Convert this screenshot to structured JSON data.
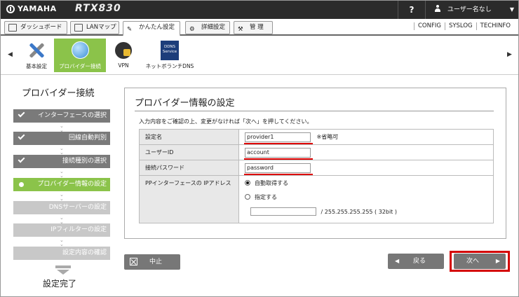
{
  "brand": "YAMAHA",
  "model": "RTX830",
  "help": "?",
  "user": "ユーザー名なし",
  "nav": {
    "tabs": [
      "ダッシュボード",
      "LANマップ",
      "かんたん設定",
      "詳細設定",
      "管 理"
    ],
    "links": [
      "CONFIG",
      "SYSLOG",
      "TECHINFO"
    ]
  },
  "categories": [
    "基本設定",
    "プロバイダー接続",
    "VPN",
    "ネットボランチDNS"
  ],
  "ddns_icon": "DDNS Service",
  "steps": {
    "title": "プロバイダー接続",
    "items": [
      "インターフェースの選択",
      "回線自動判別",
      "接続種別の選択",
      "プロバイダー情報の設定",
      "DNSサーバーの設定",
      "IPフィルターの設定",
      "設定内容の確認"
    ],
    "done": "設定完了"
  },
  "panel": {
    "title": "プロバイダー情報の設定",
    "description": "入力内容をご確認の上、変更がなければ「次へ」を押してください。",
    "rows": {
      "name_label": "設定名",
      "name_value": "provider1",
      "name_note": "※省略可",
      "userid_label": "ユーザーID",
      "userid_value": "account",
      "password_label": "接続パスワード",
      "password_value": "password",
      "ip_label": "PPインターフェースの IPアドレス",
      "ip_auto": "自動取得する",
      "ip_manual": "指定する",
      "ip_mask": "/ 255.255.255.255 ( 32bit )"
    }
  },
  "buttons": {
    "cancel": "中止",
    "back": "戻る",
    "next": "次へ"
  }
}
